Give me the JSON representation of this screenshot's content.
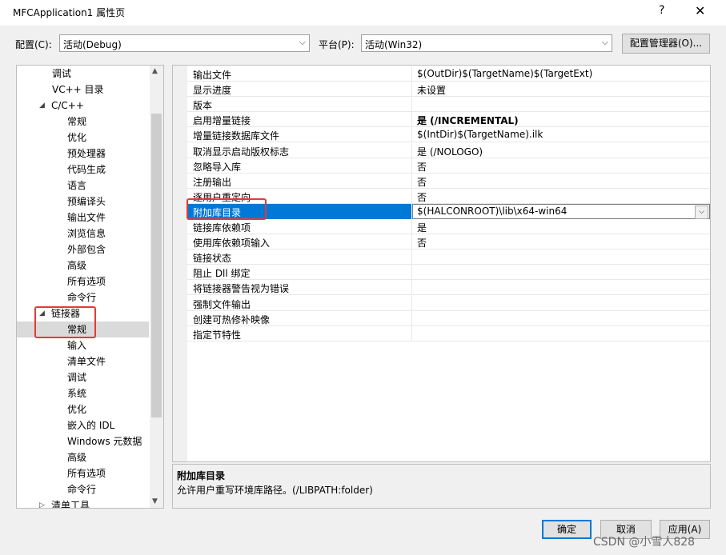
{
  "window": {
    "title": "MFCApplication1 属性页",
    "help_label": "?",
    "close_label": "✕"
  },
  "config_bar": {
    "config_label": "配置(C):",
    "config_value": "活动(Debug)",
    "platform_label": "平台(P):",
    "platform_value": "活动(Win32)",
    "manager_button": "配置管理器(O)..."
  },
  "tree": {
    "items": [
      {
        "label": "调试",
        "indent": 2
      },
      {
        "label": "VC++ 目录",
        "indent": 2
      },
      {
        "label": "C/C++",
        "indent": 1,
        "expanded": true
      },
      {
        "label": "常规",
        "indent": 3
      },
      {
        "label": "优化",
        "indent": 3
      },
      {
        "label": "预处理器",
        "indent": 3
      },
      {
        "label": "代码生成",
        "indent": 3
      },
      {
        "label": "语言",
        "indent": 3
      },
      {
        "label": "预编译头",
        "indent": 3
      },
      {
        "label": "输出文件",
        "indent": 3
      },
      {
        "label": "浏览信息",
        "indent": 3
      },
      {
        "label": "外部包含",
        "indent": 3
      },
      {
        "label": "高级",
        "indent": 3
      },
      {
        "label": "所有选项",
        "indent": 3
      },
      {
        "label": "命令行",
        "indent": 3
      },
      {
        "label": "链接器",
        "indent": 1,
        "expanded": true
      },
      {
        "label": "常规",
        "indent": 3,
        "selected": true
      },
      {
        "label": "输入",
        "indent": 3
      },
      {
        "label": "清单文件",
        "indent": 3
      },
      {
        "label": "调试",
        "indent": 3
      },
      {
        "label": "系统",
        "indent": 3
      },
      {
        "label": "优化",
        "indent": 3
      },
      {
        "label": "嵌入的 IDL",
        "indent": 3
      },
      {
        "label": "Windows 元数据",
        "indent": 3
      },
      {
        "label": "高级",
        "indent": 3
      },
      {
        "label": "所有选项",
        "indent": 3
      },
      {
        "label": "命令行",
        "indent": 3
      },
      {
        "label": "清单工具",
        "indent": 1,
        "expanded": false
      }
    ]
  },
  "properties": [
    {
      "name": "输出文件",
      "value": "$(OutDir)$(TargetName)$(TargetExt)"
    },
    {
      "name": "显示进度",
      "value": "未设置"
    },
    {
      "name": "版本",
      "value": ""
    },
    {
      "name": "启用增量链接",
      "value": "是 (/INCREMENTAL)",
      "bold": true
    },
    {
      "name": "增量链接数据库文件",
      "value": "$(IntDir)$(TargetName).ilk"
    },
    {
      "name": "取消显示启动版权标志",
      "value": "是 (/NOLOGO)"
    },
    {
      "name": "忽略导入库",
      "value": "否"
    },
    {
      "name": "注册输出",
      "value": "否"
    },
    {
      "name": "逐用户重定向",
      "value": "否"
    },
    {
      "name": "附加库目录",
      "value": "$(HALCONROOT)\\lib\\x64-win64",
      "selected": true
    },
    {
      "name": "链接库依赖项",
      "value": "是"
    },
    {
      "name": "使用库依赖项输入",
      "value": "否"
    },
    {
      "name": "链接状态",
      "value": ""
    },
    {
      "name": "阻止 Dll 绑定",
      "value": ""
    },
    {
      "name": "将链接器警告视为错误",
      "value": ""
    },
    {
      "name": "强制文件输出",
      "value": ""
    },
    {
      "name": "创建可热修补映像",
      "value": ""
    },
    {
      "name": "指定节特性",
      "value": ""
    }
  ],
  "description": {
    "title": "附加库目录",
    "text": "允许用户重写环境库路径。(/LIBPATH:folder)"
  },
  "buttons": {
    "ok": "确定",
    "cancel": "取消",
    "apply": "应用(A)"
  },
  "watermark": "CSDN @小雪人828",
  "colors": {
    "selection": "#0078d7",
    "annotation": "#e53935"
  }
}
